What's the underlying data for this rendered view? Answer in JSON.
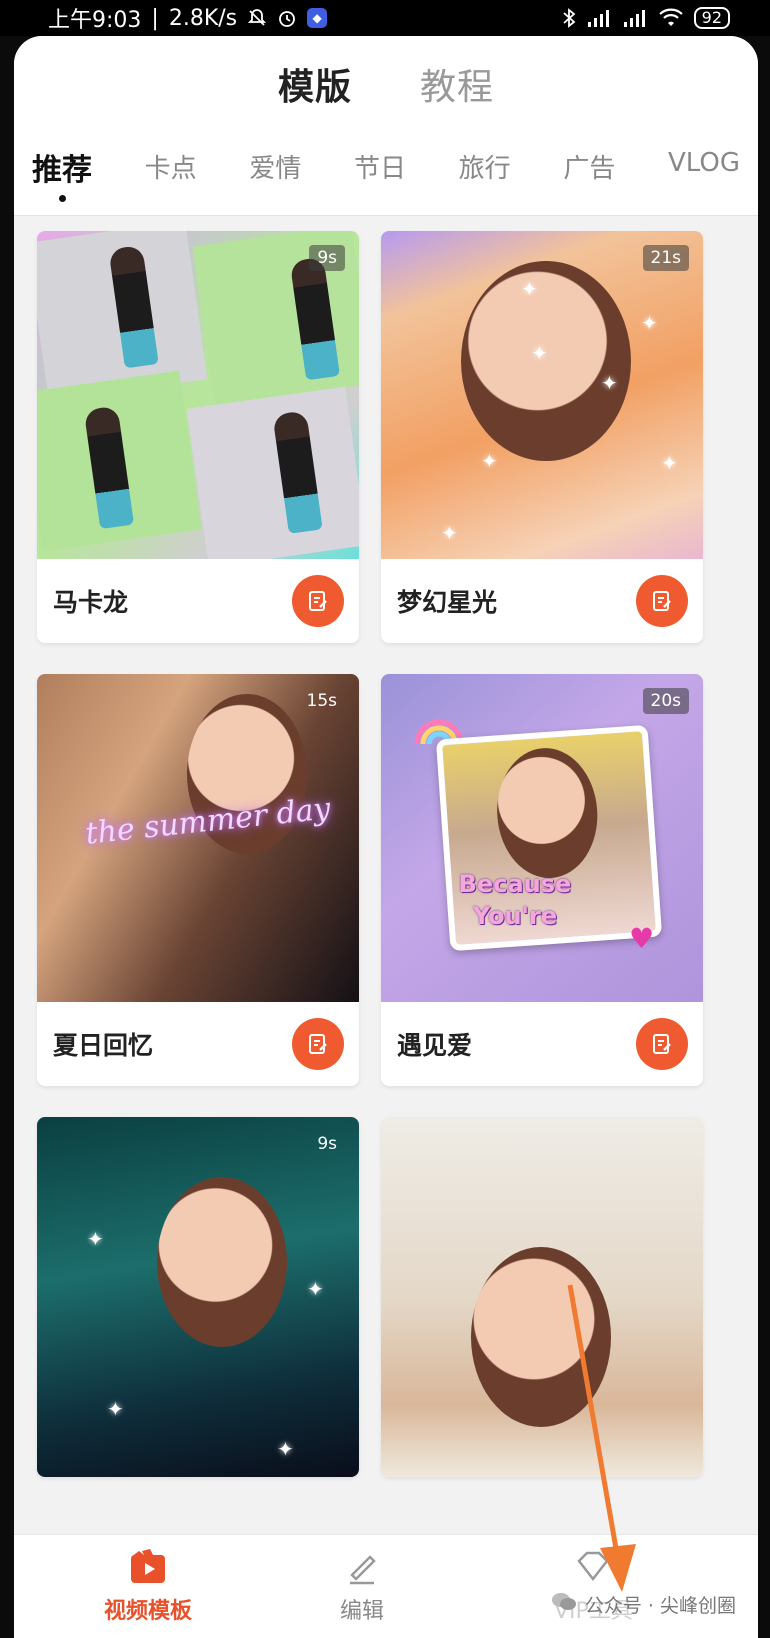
{
  "status_bar": {
    "time": "上午9:03",
    "speed": "2.8K/s",
    "battery": "92"
  },
  "header": {
    "tabs": [
      {
        "label": "模版"
      },
      {
        "label": "教程"
      }
    ]
  },
  "categories": [
    {
      "label": "推荐"
    },
    {
      "label": "卡点"
    },
    {
      "label": "爱情"
    },
    {
      "label": "节日"
    },
    {
      "label": "旅行"
    },
    {
      "label": "广告"
    },
    {
      "label": "VLOG"
    }
  ],
  "templates": [
    {
      "title": "马卡龙",
      "duration": "9s"
    },
    {
      "title": "梦幻星光",
      "duration": "21s"
    },
    {
      "title": "夏日回忆",
      "duration": "15s"
    },
    {
      "title": "遇见爱",
      "duration": "20s"
    },
    {
      "title": "",
      "duration": "9s"
    },
    {
      "title": "",
      "duration": ""
    }
  ],
  "thumb_text": {
    "summer": "the summer day",
    "because": "Because",
    "youre": "You're"
  },
  "bottom_nav": [
    {
      "label": "视频模板",
      "icon": "video-template-icon"
    },
    {
      "label": "编辑",
      "icon": "edit-pencil-icon"
    },
    {
      "label": "VIP工具",
      "icon": "vip-diamond-icon"
    }
  ],
  "watermark": "公众号 · 尖峰创圈",
  "colors": {
    "accent": "#F05A30",
    "annotation_arrow": "#F07A30"
  }
}
